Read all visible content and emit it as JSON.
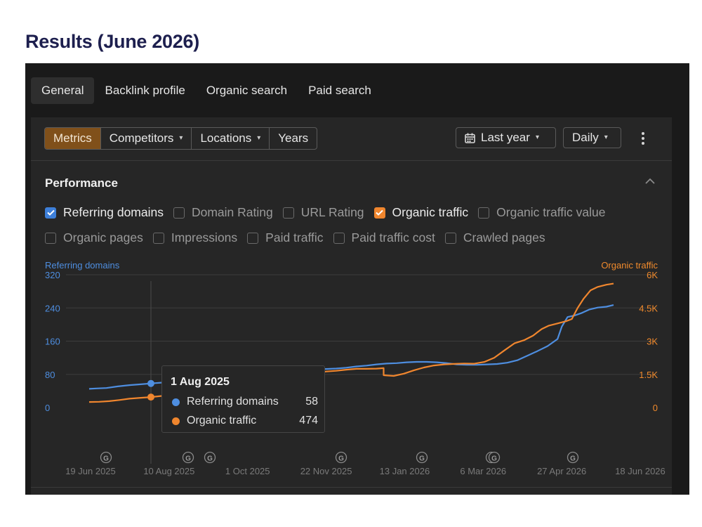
{
  "page_title": "Results (June 2026)",
  "top_tabs": [
    {
      "label": "General",
      "active": true
    },
    {
      "label": "Backlink profile",
      "active": false
    },
    {
      "label": "Organic search",
      "active": false
    },
    {
      "label": "Paid search",
      "active": false
    }
  ],
  "toolbar": {
    "segments": [
      {
        "label": "Metrics",
        "active": true,
        "dropdown": false
      },
      {
        "label": "Competitors",
        "active": false,
        "dropdown": true
      },
      {
        "label": "Locations",
        "active": false,
        "dropdown": true
      },
      {
        "label": "Years",
        "active": false,
        "dropdown": false
      }
    ],
    "date_range": "Last year",
    "interval": "Daily",
    "icons": {
      "calendar": "calendar-icon",
      "more": "more-vertical-icon"
    }
  },
  "performance": {
    "title": "Performance",
    "metrics_row1": [
      {
        "label": "Referring domains",
        "checked": true,
        "color": "#3d7fd9"
      },
      {
        "label": "Domain Rating",
        "checked": false
      },
      {
        "label": "URL Rating",
        "checked": false
      },
      {
        "label": "Organic traffic",
        "checked": true,
        "color": "#f0862e"
      },
      {
        "label": "Organic traffic value",
        "checked": false
      }
    ],
    "metrics_row2": [
      {
        "label": "Organic pages",
        "checked": false
      },
      {
        "label": "Impressions",
        "checked": false
      },
      {
        "label": "Paid traffic",
        "checked": false
      },
      {
        "label": "Paid traffic cost",
        "checked": false
      },
      {
        "label": "Crawled pages",
        "checked": false
      }
    ]
  },
  "tooltip": {
    "date": "1 Aug 2025",
    "rows": [
      {
        "label": "Referring domains",
        "value": "58",
        "color": "#4e8ee0"
      },
      {
        "label": "Organic traffic",
        "value": "474",
        "color": "#f0862e"
      }
    ]
  },
  "chart_data": {
    "type": "line",
    "left_axis_label": "Referring domains",
    "right_axis_label": "Organic traffic",
    "left_ticks": [
      "0",
      "80",
      "160",
      "240",
      "320"
    ],
    "left_tick_values": [
      0,
      80,
      160,
      240,
      320
    ],
    "right_ticks": [
      "0",
      "1.5K",
      "3K",
      "4.5K",
      "6K"
    ],
    "right_tick_values": [
      0,
      1500,
      3000,
      4500,
      6000
    ],
    "x_ticks": [
      "19 Jun 2025",
      "10 Aug 2025",
      "1 Oct 2025",
      "22 Nov 2025",
      "13 Jan 2026",
      "6 Mar 2026",
      "27 Apr 2026",
      "18 Jun 2026"
    ],
    "ylim_left": [
      0,
      320
    ],
    "ylim_right": [
      0,
      6000
    ],
    "grid": true,
    "google_update_markers": [
      "G",
      "G",
      "G",
      "G",
      "G",
      "G",
      "G",
      "G"
    ],
    "series": [
      {
        "name": "Referring domains",
        "axis": "left",
        "color": "#4e8ee0",
        "points": [
          [
            0,
            45
          ],
          [
            5,
            46
          ],
          [
            12,
            47
          ],
          [
            20,
            51
          ],
          [
            28,
            54
          ],
          [
            36,
            56
          ],
          [
            43,
            58
          ],
          [
            50,
            60
          ],
          [
            57,
            61
          ],
          [
            64,
            62
          ],
          [
            72,
            63
          ],
          [
            80,
            64
          ],
          [
            88,
            64
          ],
          [
            95,
            65
          ],
          [
            102,
            65
          ],
          [
            109,
            68
          ],
          [
            116,
            74
          ],
          [
            123,
            79
          ],
          [
            130,
            86
          ],
          [
            137,
            89
          ],
          [
            144,
            91
          ],
          [
            151,
            92
          ],
          [
            158,
            93
          ],
          [
            165,
            93
          ],
          [
            172,
            94
          ],
          [
            179,
            96
          ],
          [
            186,
            99
          ],
          [
            193,
            101
          ],
          [
            200,
            104
          ],
          [
            207,
            106
          ],
          [
            214,
            107
          ],
          [
            221,
            109
          ],
          [
            228,
            110
          ],
          [
            235,
            110
          ],
          [
            242,
            109
          ],
          [
            249,
            107
          ],
          [
            256,
            104
          ],
          [
            263,
            103
          ],
          [
            270,
            103
          ],
          [
            277,
            104
          ],
          [
            284,
            105
          ],
          [
            291,
            108
          ],
          [
            298,
            114
          ],
          [
            305,
            125
          ],
          [
            312,
            136
          ],
          [
            319,
            148
          ],
          [
            326,
            165
          ],
          [
            329,
            195
          ],
          [
            333,
            218
          ],
          [
            338,
            222
          ],
          [
            343,
            228
          ],
          [
            348,
            236
          ],
          [
            354,
            241
          ],
          [
            360,
            243
          ],
          [
            365,
            247
          ]
        ]
      },
      {
        "name": "Organic traffic",
        "axis": "right",
        "color": "#f0862e",
        "points": [
          [
            0,
            250
          ],
          [
            7,
            260
          ],
          [
            14,
            290
          ],
          [
            21,
            340
          ],
          [
            28,
            400
          ],
          [
            36,
            440
          ],
          [
            43,
            474
          ],
          [
            50,
            520
          ],
          [
            57,
            560
          ],
          [
            64,
            590
          ],
          [
            72,
            590
          ],
          [
            80,
            570
          ],
          [
            88,
            560
          ],
          [
            95,
            560
          ],
          [
            102,
            620
          ],
          [
            109,
            760
          ],
          [
            116,
            900
          ],
          [
            123,
            1150
          ],
          [
            130,
            1400
          ],
          [
            137,
            1550
          ],
          [
            144,
            1550
          ],
          [
            151,
            1530
          ],
          [
            158,
            1560
          ],
          [
            165,
            1630
          ],
          [
            172,
            1660
          ],
          [
            179,
            1710
          ],
          [
            186,
            1750
          ],
          [
            193,
            1750
          ],
          [
            200,
            1760
          ],
          [
            205,
            1780
          ],
          [
            205,
            1460
          ],
          [
            212,
            1430
          ],
          [
            219,
            1530
          ],
          [
            226,
            1680
          ],
          [
            233,
            1810
          ],
          [
            240,
            1900
          ],
          [
            247,
            1950
          ],
          [
            254,
            1970
          ],
          [
            261,
            1990
          ],
          [
            268,
            1980
          ],
          [
            275,
            2060
          ],
          [
            282,
            2250
          ],
          [
            289,
            2580
          ],
          [
            296,
            2900
          ],
          [
            303,
            3050
          ],
          [
            309,
            3250
          ],
          [
            312,
            3400
          ],
          [
            315,
            3550
          ],
          [
            320,
            3700
          ],
          [
            326,
            3800
          ],
          [
            332,
            3900
          ],
          [
            336,
            4000
          ],
          [
            340,
            4500
          ],
          [
            344,
            4900
          ],
          [
            349,
            5300
          ],
          [
            354,
            5450
          ],
          [
            360,
            5550
          ],
          [
            365,
            5600
          ]
        ]
      }
    ]
  }
}
